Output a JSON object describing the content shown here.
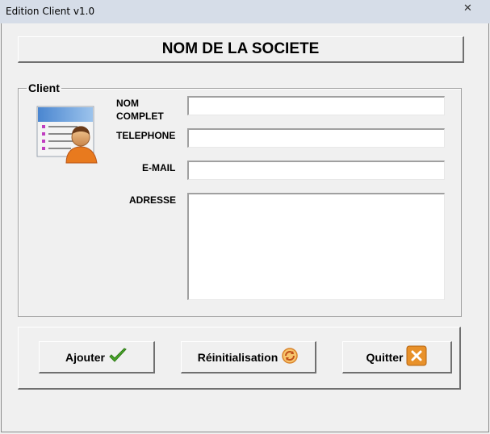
{
  "window": {
    "title": "Edition Client v1.0",
    "close_glyph": "✕"
  },
  "company": {
    "name": "NOM DE LA SOCIETE"
  },
  "client_frame": {
    "legend": "Client",
    "icon": "client-card-icon",
    "fields": {
      "nom_label": "NOM COMPLET",
      "nom_value": "",
      "telephone_label": "TELEPHONE",
      "telephone_value": "",
      "email_label": "E-MAIL",
      "email_value": "",
      "adresse_label": "ADRESSE",
      "adresse_value": ""
    }
  },
  "buttons": {
    "ajouter": {
      "label": "Ajouter",
      "icon": "checkmark-icon"
    },
    "reinit": {
      "label": "Réinitialisation",
      "icon": "refresh-icon"
    },
    "quitter": {
      "label": "Quitter",
      "icon": "close-box-icon"
    }
  },
  "colors": {
    "background": "#f0f0f0",
    "field_bg": "#ffffff",
    "check_green": "#4aa82a",
    "quit_orange": "#e8912a"
  }
}
